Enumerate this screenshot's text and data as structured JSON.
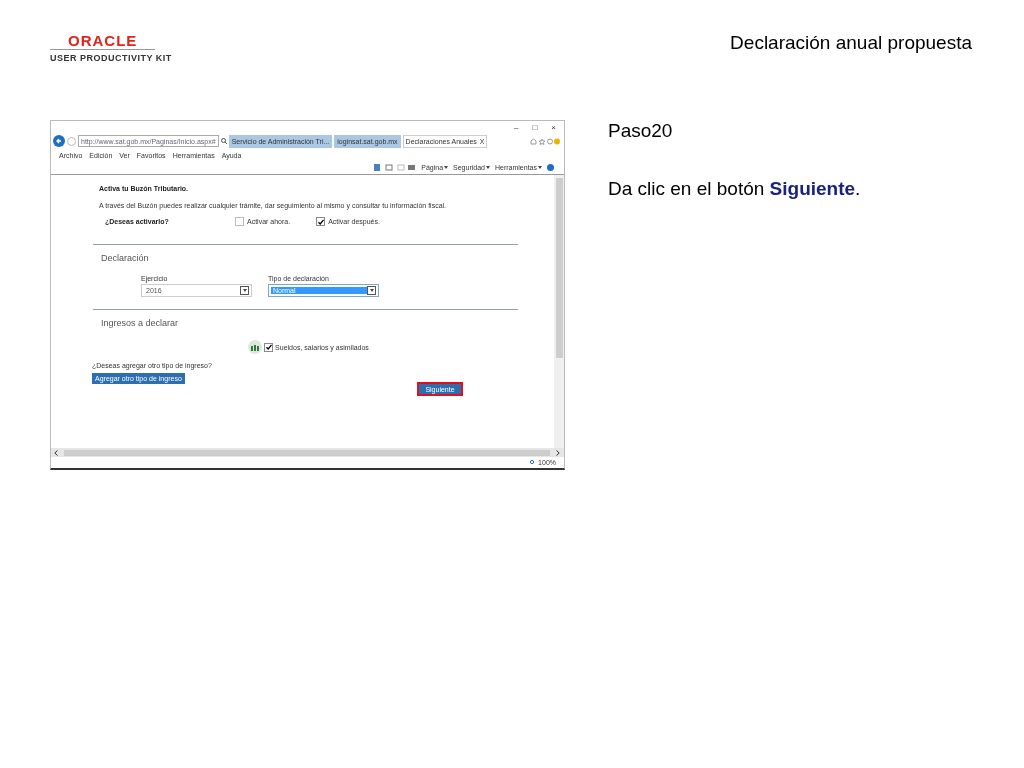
{
  "header": {
    "logo": {
      "wordmark": "ORACLE",
      "product": "USER PRODUCTIVITY KIT"
    },
    "title": "Declaración anual propuesta"
  },
  "browser": {
    "window_controls": [
      "–",
      "□",
      "×"
    ],
    "address": "http://www.sat.gob.mx/Paginas/Inicio.aspx#",
    "tabs": [
      {
        "label": "Servicio de Administración Tri...",
        "selected": false
      },
      {
        "label": "loginsat.sat.gob.mx",
        "selected": false
      },
      {
        "label": "Declaraciones Anuales",
        "selected": true,
        "close": "X"
      }
    ],
    "menu": [
      "Archivo",
      "Edición",
      "Ver",
      "Favoritos",
      "Herramientas",
      "Ayuda"
    ],
    "commands": [
      "Página",
      "Seguridad",
      "Herramientas"
    ],
    "zoom": "100%"
  },
  "page": {
    "buzon": {
      "title": "Activa tu Buzón Tributario.",
      "description": "A través del Buzón puedes realizar cualquier trámite, dar seguimiento al mismo y consultar tu información fiscal.",
      "question": "¿Deseas activarlo?",
      "options": [
        {
          "label": "Activar ahora.",
          "checked": false
        },
        {
          "label": "Activar después.",
          "checked": true
        }
      ]
    },
    "declaracion": {
      "heading": "Declaración",
      "fields": [
        {
          "label": "Ejercicio",
          "value": "2016",
          "focused": false
        },
        {
          "label": "Tipo de declaración",
          "value": "Normal",
          "focused": true
        }
      ]
    },
    "ingresos": {
      "heading": "Ingresos a declarar",
      "items": [
        {
          "label": "Sueldos, salarios y asimilados",
          "checked": true
        }
      ],
      "question": "¿Deseas agregar otro tipo de ingreso?",
      "add_button": "Agregar otro tipo de ingreso",
      "next_button": {
        "label": "Siguiente",
        "highlighted": true
      }
    }
  },
  "step": {
    "label": "Paso20",
    "instruction": "Da clic en el botón **Siguiente**."
  }
}
